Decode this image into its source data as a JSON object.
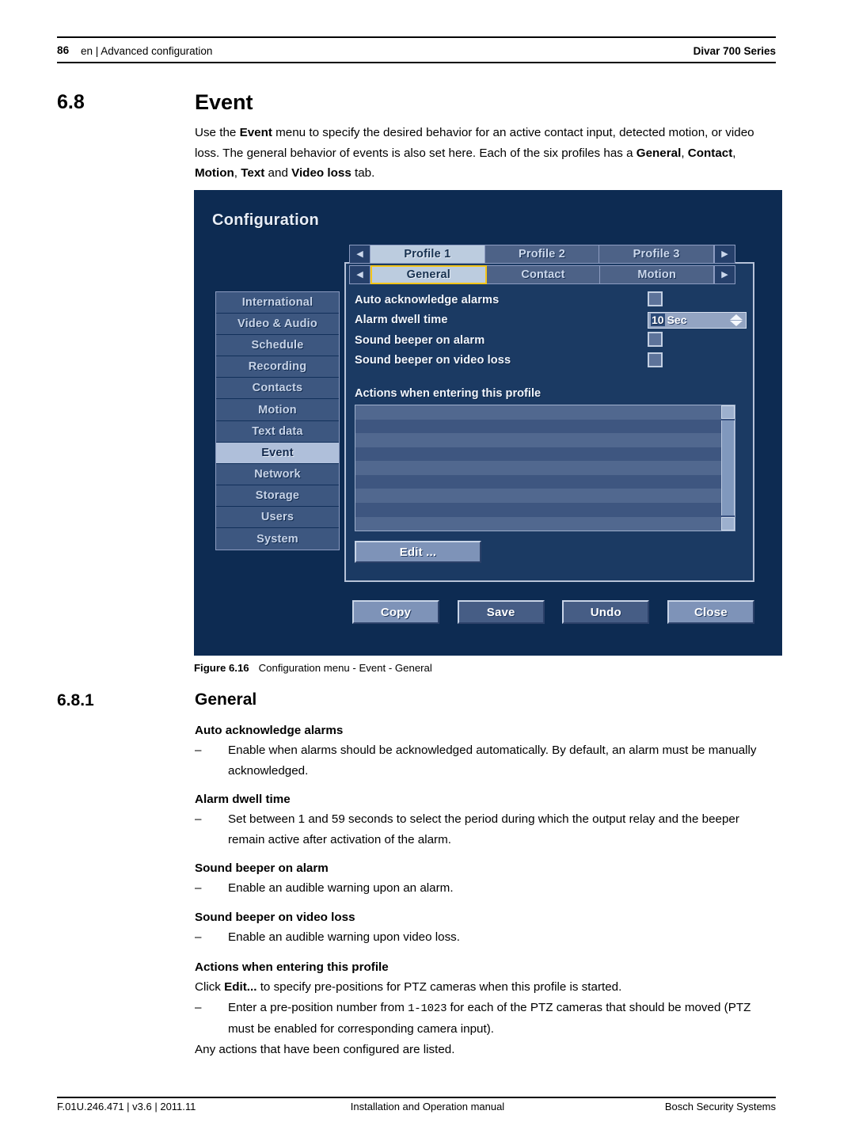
{
  "header": {
    "page_number": "86",
    "left_text": "en | Advanced configuration",
    "right_text": "Divar 700 Series"
  },
  "section": {
    "number": "6.8",
    "title": "Event",
    "intro_html": "Use the <b>Event</b> menu to specify the desired behavior for an active contact input, detected motion, or video loss. The general behavior of events is also set here. Each of the six profiles has a <b>General</b>, <b>Contact</b>, <b>Motion</b>, <b>Text</b> and <b>Video loss</b> tab."
  },
  "figure": {
    "screen_title": "Configuration",
    "sidebar": {
      "items": [
        {
          "label": "International",
          "selected": false
        },
        {
          "label": "Video & Audio",
          "selected": false
        },
        {
          "label": "Schedule",
          "selected": false
        },
        {
          "label": "Recording",
          "selected": false
        },
        {
          "label": "Contacts",
          "selected": false
        },
        {
          "label": "Motion",
          "selected": false
        },
        {
          "label": "Text data",
          "selected": false
        },
        {
          "label": "Event",
          "selected": true
        },
        {
          "label": "Network",
          "selected": false
        },
        {
          "label": "Storage",
          "selected": false
        },
        {
          "label": "Users",
          "selected": false
        },
        {
          "label": "System",
          "selected": false
        }
      ]
    },
    "profile_tabs": {
      "prev_arrow": "◀",
      "next_arrow": "▶",
      "items": [
        {
          "label": "Profile 1",
          "selected": true
        },
        {
          "label": "Profile 2",
          "selected": false
        },
        {
          "label": "Profile 3",
          "selected": false
        }
      ]
    },
    "section_tabs": {
      "prev_arrow": "◀",
      "next_arrow": "▶",
      "items": [
        {
          "label": "General",
          "selected": true,
          "focused": true
        },
        {
          "label": "Contact",
          "selected": false,
          "focused": false
        },
        {
          "label": "Motion",
          "selected": false,
          "focused": false
        }
      ]
    },
    "settings": [
      {
        "label": "Auto acknowledge alarms",
        "control": "checkbox",
        "checked": false
      },
      {
        "label": "Alarm dwell time",
        "control": "spinner",
        "value": "10",
        "unit": "Sec"
      },
      {
        "label": "Sound beeper on alarm",
        "control": "checkbox",
        "checked": false
      },
      {
        "label": "Sound beeper on video loss",
        "control": "checkbox",
        "checked": false
      }
    ],
    "actions": {
      "label": "Actions when entering this profile",
      "list_items": [],
      "edit_button": "Edit ...",
      "scroll_up_arrow": "",
      "scroll_down_arrow": ""
    },
    "buttons": [
      {
        "label": "Copy",
        "dim": false
      },
      {
        "label": "Save",
        "dim": true
      },
      {
        "label": "Undo",
        "dim": true
      },
      {
        "label": "Close",
        "dim": false
      }
    ],
    "colors": {
      "background": "#0d2b52",
      "panel": "#1b3a63",
      "tab_selected": "#bcccdf",
      "tab_unselected": "#4d6287",
      "focus_border": "#f5c518",
      "button": "#7e93b8"
    }
  },
  "figure_caption": {
    "label": "Figure 6.16",
    "text": "Configuration menu - Event - General"
  },
  "subsection": {
    "number": "6.8.1",
    "title": "General",
    "entries": [
      {
        "term": "Auto acknowledge alarms",
        "dashes": [
          "Enable when alarms should be acknowledged automatically. By default, an alarm must be manually acknowledged."
        ]
      },
      {
        "term": "Alarm dwell time",
        "dashes": [
          "Set between 1 and 59 seconds to select the period during which the output relay and the beeper remain active after activation of the alarm."
        ]
      },
      {
        "term": "Sound beeper on alarm",
        "dashes": [
          "Enable an audible warning upon an alarm."
        ]
      },
      {
        "term": "Sound beeper on video loss",
        "dashes": [
          "Enable an audible warning upon video loss."
        ]
      }
    ],
    "actions_entry": {
      "term": "Actions when entering this profile",
      "lead_html": "Click <b>Edit...</b> to specify pre-positions for PTZ cameras when this profile is started.",
      "dash_html": "Enter a pre-position number from <span class=\"mono\">1-1023</span> for each of the PTZ cameras that should be moved (PTZ must be enabled for corresponding camera input).",
      "closing": "Any actions that have been configured are listed."
    }
  },
  "footer": {
    "left": "F.01U.246.471 | v3.6 | 2011.11",
    "center": "Installation and Operation manual",
    "right": "Bosch Security Systems"
  },
  "dash_glyph": "–"
}
